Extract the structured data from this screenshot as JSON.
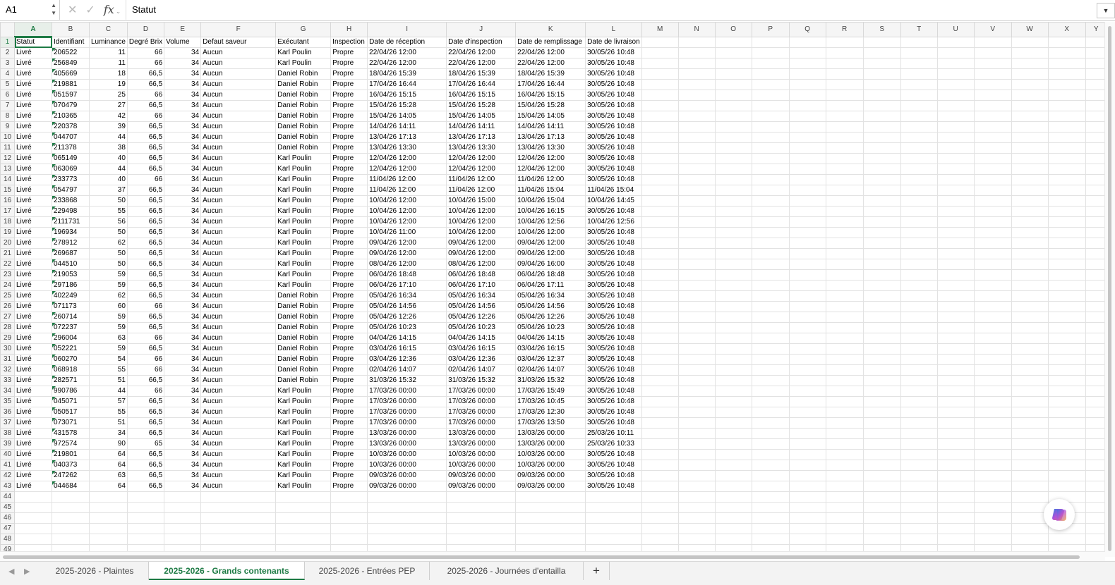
{
  "namebox": {
    "value": "A1"
  },
  "formula_bar": {
    "fx_label": "fx",
    "value": "Statut"
  },
  "columns": [
    "A",
    "B",
    "C",
    "D",
    "E",
    "F",
    "G",
    "H",
    "I",
    "J",
    "K",
    "L",
    "M",
    "N",
    "O",
    "P",
    "Q",
    "R",
    "S",
    "T",
    "U",
    "V",
    "W",
    "X",
    "Y"
  ],
  "headers": [
    "Statut",
    "Identifiant",
    "Luminance",
    "Degré Brix",
    "Volume",
    "Defaut saveur",
    "Exécutant",
    "Inspection",
    "Date de réception",
    "Date d'inspection",
    "Date de remplissage",
    "Date de livraison"
  ],
  "rows": [
    [
      "Livré",
      "206522",
      "11",
      "66",
      "34",
      "Aucun",
      "Karl Poulin",
      "Propre",
      "22/04/26 12:00",
      "22/04/26 12:00",
      "22/04/26 12:00",
      "30/05/26 10:48"
    ],
    [
      "Livré",
      "256849",
      "11",
      "66",
      "34",
      "Aucun",
      "Karl Poulin",
      "Propre",
      "22/04/26 12:00",
      "22/04/26 12:00",
      "22/04/26 12:00",
      "30/05/26 10:48"
    ],
    [
      "Livré",
      "405669",
      "18",
      "66,5",
      "34",
      "Aucun",
      "Daniel Robin",
      "Propre",
      "18/04/26 15:39",
      "18/04/26 15:39",
      "18/04/26 15:39",
      "30/05/26 10:48"
    ],
    [
      "Livré",
      "219881",
      "19",
      "66,5",
      "34",
      "Aucun",
      "Daniel Robin",
      "Propre",
      "17/04/26 16:44",
      "17/04/26 16:44",
      "17/04/26 16:44",
      "30/05/26 10:48"
    ],
    [
      "Livré",
      "051597",
      "25",
      "66",
      "34",
      "Aucun",
      "Daniel Robin",
      "Propre",
      "16/04/26 15:15",
      "16/04/26 15:15",
      "16/04/26 15:15",
      "30/05/26 10:48"
    ],
    [
      "Livré",
      "070479",
      "27",
      "66,5",
      "34",
      "Aucun",
      "Daniel Robin",
      "Propre",
      "15/04/26 15:28",
      "15/04/26 15:28",
      "15/04/26 15:28",
      "30/05/26 10:48"
    ],
    [
      "Livré",
      "210365",
      "42",
      "66",
      "34",
      "Aucun",
      "Daniel Robin",
      "Propre",
      "15/04/26 14:05",
      "15/04/26 14:05",
      "15/04/26 14:05",
      "30/05/26 10:48"
    ],
    [
      "Livré",
      "220378",
      "39",
      "66,5",
      "34",
      "Aucun",
      "Daniel Robin",
      "Propre",
      "14/04/26 14:11",
      "14/04/26 14:11",
      "14/04/26 14:11",
      "30/05/26 10:48"
    ],
    [
      "Livré",
      "044707",
      "44",
      "66,5",
      "34",
      "Aucun",
      "Daniel Robin",
      "Propre",
      "13/04/26 17:13",
      "13/04/26 17:13",
      "13/04/26 17:13",
      "30/05/26 10:48"
    ],
    [
      "Livré",
      "211378",
      "38",
      "66,5",
      "34",
      "Aucun",
      "Daniel Robin",
      "Propre",
      "13/04/26 13:30",
      "13/04/26 13:30",
      "13/04/26 13:30",
      "30/05/26 10:48"
    ],
    [
      "Livré",
      "065149",
      "40",
      "66,5",
      "34",
      "Aucun",
      "Karl Poulin",
      "Propre",
      "12/04/26 12:00",
      "12/04/26 12:00",
      "12/04/26 12:00",
      "30/05/26 10:48"
    ],
    [
      "Livré",
      "063069",
      "44",
      "66,5",
      "34",
      "Aucun",
      "Karl Poulin",
      "Propre",
      "12/04/26 12:00",
      "12/04/26 12:00",
      "12/04/26 12:00",
      "30/05/26 10:48"
    ],
    [
      "Livré",
      "233773",
      "40",
      "66",
      "34",
      "Aucun",
      "Karl Poulin",
      "Propre",
      "11/04/26 12:00",
      "11/04/26 12:00",
      "11/04/26 12:00",
      "30/05/26 10:48"
    ],
    [
      "Livré",
      "054797",
      "37",
      "66,5",
      "34",
      "Aucun",
      "Karl Poulin",
      "Propre",
      "11/04/26 12:00",
      "11/04/26 12:00",
      "11/04/26 15:04",
      "11/04/26 15:04"
    ],
    [
      "Livré",
      "233868",
      "50",
      "66,5",
      "34",
      "Aucun",
      "Karl Poulin",
      "Propre",
      "10/04/26 12:00",
      "10/04/26 15:00",
      "10/04/26 15:04",
      "10/04/26 14:45"
    ],
    [
      "Livré",
      "229498",
      "55",
      "66,5",
      "34",
      "Aucun",
      "Karl Poulin",
      "Propre",
      "10/04/26 12:00",
      "10/04/26 12:00",
      "10/04/26 16:15",
      "30/05/26 10:48"
    ],
    [
      "Livré",
      "2111731",
      "56",
      "66,5",
      "34",
      "Aucun",
      "Karl Poulin",
      "Propre",
      "10/04/26 12:00",
      "10/04/26 12:00",
      "10/04/26 12:56",
      "10/04/26 12:56"
    ],
    [
      "Livré",
      "196934",
      "50",
      "66,5",
      "34",
      "Aucun",
      "Karl Poulin",
      "Propre",
      "10/04/26 11:00",
      "10/04/26 12:00",
      "10/04/26 12:00",
      "30/05/26 10:48"
    ],
    [
      "Livré",
      "278912",
      "62",
      "66,5",
      "34",
      "Aucun",
      "Karl Poulin",
      "Propre",
      "09/04/26 12:00",
      "09/04/26 12:00",
      "09/04/26 12:00",
      "30/05/26 10:48"
    ],
    [
      "Livré",
      "269687",
      "50",
      "66,5",
      "34",
      "Aucun",
      "Karl Poulin",
      "Propre",
      "09/04/26 12:00",
      "09/04/26 12:00",
      "09/04/26 12:00",
      "30/05/26 10:48"
    ],
    [
      "Livré",
      "044510",
      "50",
      "66,5",
      "34",
      "Aucun",
      "Karl Poulin",
      "Propre",
      "08/04/26 12:00",
      "08/04/26 12:00",
      "09/04/26 16:00",
      "30/05/26 10:48"
    ],
    [
      "Livré",
      "219053",
      "59",
      "66,5",
      "34",
      "Aucun",
      "Karl Poulin",
      "Propre",
      "06/04/26 18:48",
      "06/04/26 18:48",
      "06/04/26 18:48",
      "30/05/26 10:48"
    ],
    [
      "Livré",
      "297186",
      "59",
      "66,5",
      "34",
      "Aucun",
      "Karl Poulin",
      "Propre",
      "06/04/26 17:10",
      "06/04/26 17:10",
      "06/04/26 17:11",
      "30/05/26 10:48"
    ],
    [
      "Livré",
      "402249",
      "62",
      "66,5",
      "34",
      "Aucun",
      "Daniel Robin",
      "Propre",
      "05/04/26 16:34",
      "05/04/26 16:34",
      "05/04/26 16:34",
      "30/05/26 10:48"
    ],
    [
      "Livré",
      "071173",
      "60",
      "66",
      "34",
      "Aucun",
      "Daniel Robin",
      "Propre",
      "05/04/26 14:56",
      "05/04/26 14:56",
      "05/04/26 14:56",
      "30/05/26 10:48"
    ],
    [
      "Livré",
      "260714",
      "59",
      "66,5",
      "34",
      "Aucun",
      "Daniel Robin",
      "Propre",
      "05/04/26 12:26",
      "05/04/26 12:26",
      "05/04/26 12:26",
      "30/05/26 10:48"
    ],
    [
      "Livré",
      "072237",
      "59",
      "66,5",
      "34",
      "Aucun",
      "Daniel Robin",
      "Propre",
      "05/04/26 10:23",
      "05/04/26 10:23",
      "05/04/26 10:23",
      "30/05/26 10:48"
    ],
    [
      "Livré",
      "296004",
      "63",
      "66",
      "34",
      "Aucun",
      "Daniel Robin",
      "Propre",
      "04/04/26 14:15",
      "04/04/26 14:15",
      "04/04/26 14:15",
      "30/05/26 10:48"
    ],
    [
      "Livré",
      "052221",
      "59",
      "66,5",
      "34",
      "Aucun",
      "Daniel Robin",
      "Propre",
      "03/04/26 16:15",
      "03/04/26 16:15",
      "03/04/26 16:15",
      "30/05/26 10:48"
    ],
    [
      "Livré",
      "060270",
      "54",
      "66",
      "34",
      "Aucun",
      "Daniel Robin",
      "Propre",
      "03/04/26 12:36",
      "03/04/26 12:36",
      "03/04/26 12:37",
      "30/05/26 10:48"
    ],
    [
      "Livré",
      "068918",
      "55",
      "66",
      "34",
      "Aucun",
      "Daniel Robin",
      "Propre",
      "02/04/26 14:07",
      "02/04/26 14:07",
      "02/04/26 14:07",
      "30/05/26 10:48"
    ],
    [
      "Livré",
      "282571",
      "51",
      "66,5",
      "34",
      "Aucun",
      "Daniel Robin",
      "Propre",
      "31/03/26 15:32",
      "31/03/26 15:32",
      "31/03/26 15:32",
      "30/05/26 10:48"
    ],
    [
      "Livré",
      "990786",
      "44",
      "66",
      "34",
      "Aucun",
      "Karl Poulin",
      "Propre",
      "17/03/26 00:00",
      "17/03/26 00:00",
      "17/03/26 15:49",
      "30/05/26 10:48"
    ],
    [
      "Livré",
      "045071",
      "57",
      "66,5",
      "34",
      "Aucun",
      "Karl Poulin",
      "Propre",
      "17/03/26 00:00",
      "17/03/26 00:00",
      "17/03/26 10:45",
      "30/05/26 10:48"
    ],
    [
      "Livré",
      "050517",
      "55",
      "66,5",
      "34",
      "Aucun",
      "Karl Poulin",
      "Propre",
      "17/03/26 00:00",
      "17/03/26 00:00",
      "17/03/26 12:30",
      "30/05/26 10:48"
    ],
    [
      "Livré",
      "073071",
      "51",
      "66,5",
      "34",
      "Aucun",
      "Karl Poulin",
      "Propre",
      "17/03/26 00:00",
      "17/03/26 00:00",
      "17/03/26 13:50",
      "30/05/26 10:48"
    ],
    [
      "Livré",
      "431578",
      "34",
      "66,5",
      "34",
      "Aucun",
      "Karl Poulin",
      "Propre",
      "13/03/26 00:00",
      "13/03/26 00:00",
      "13/03/26 00:00",
      "25/03/26 10:11"
    ],
    [
      "Livré",
      "972574",
      "90",
      "65",
      "34",
      "Aucun",
      "Karl Poulin",
      "Propre",
      "13/03/26 00:00",
      "13/03/26 00:00",
      "13/03/26 00:00",
      "25/03/26 10:33"
    ],
    [
      "Livré",
      "219801",
      "64",
      "66,5",
      "34",
      "Aucun",
      "Karl Poulin",
      "Propre",
      "10/03/26 00:00",
      "10/03/26 00:00",
      "10/03/26 00:00",
      "30/05/26 10:48"
    ],
    [
      "Livré",
      "040373",
      "64",
      "66,5",
      "34",
      "Aucun",
      "Karl Poulin",
      "Propre",
      "10/03/26 00:00",
      "10/03/26 00:00",
      "10/03/26 00:00",
      "30/05/26 10:48"
    ],
    [
      "Livré",
      "247262",
      "63",
      "66,5",
      "34",
      "Aucun",
      "Karl Poulin",
      "Propre",
      "09/03/26 00:00",
      "09/03/26 00:00",
      "09/03/26 00:00",
      "30/05/26 10:48"
    ],
    [
      "Livré",
      "044684",
      "64",
      "66,5",
      "34",
      "Aucun",
      "Karl Poulin",
      "Propre",
      "09/03/26 00:00",
      "09/03/26 00:00",
      "09/03/26 00:00",
      "30/05/26 10:48"
    ]
  ],
  "empty_row_numbers": [
    "44",
    "45",
    "46",
    "47",
    "48",
    "49"
  ],
  "tabs": [
    {
      "label": "2025-2026 - Plaintes",
      "active": false
    },
    {
      "label": "2025-2026 - Grands contenants",
      "active": true
    },
    {
      "label": "2025-2026 - Entrées PEP",
      "active": false
    },
    {
      "label": "2025-2026 - Journées d'entailla",
      "active": false
    }
  ],
  "add_sheet_label": "+",
  "icons": {
    "cancel": "close-icon",
    "confirm": "check-icon",
    "function": "fx-icon",
    "prev_sheet": "triangle-left-icon",
    "next_sheet": "triangle-right-icon",
    "copilot": "copilot-icon"
  },
  "colors": {
    "accent": "#1e7b45",
    "grid": "#e2e2e2",
    "header_bg": "#f5f5f5"
  }
}
